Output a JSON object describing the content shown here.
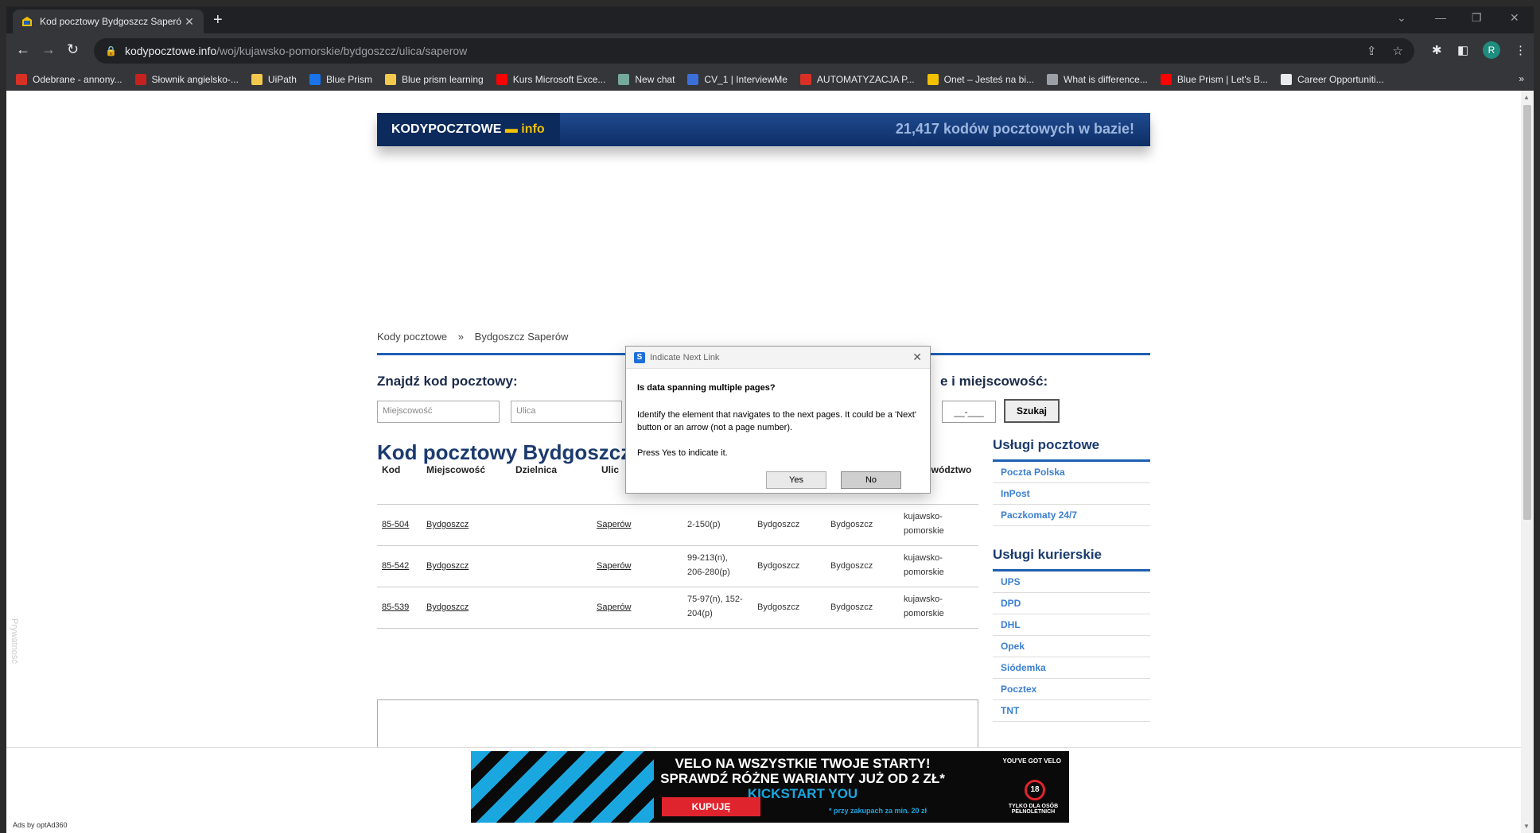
{
  "browser": {
    "tab_title": "Kod pocztowy Bydgoszcz Saperó",
    "new_tab": "+",
    "url_host": "kodypocztowe.info",
    "url_path": "/woj/kujawsko-pomorskie/bydgoszcz/ulica/saperow",
    "profile_initial": "R",
    "bookmarks": [
      {
        "label": "Odebrane - annony...",
        "color": "#d93025"
      },
      {
        "label": "Słownik angielsko-...",
        "color": "#c5221f"
      },
      {
        "label": "UiPath",
        "color": "#f2c94c"
      },
      {
        "label": "Blue Prism",
        "color": "#1a73e8"
      },
      {
        "label": "Blue prism learning",
        "color": "#f2c94c"
      },
      {
        "label": "Kurs Microsoft Exce...",
        "color": "#ff0000"
      },
      {
        "label": "New chat",
        "color": "#74aa9c"
      },
      {
        "label": "CV_1 | InterviewMe",
        "color": "#3b6fd9"
      },
      {
        "label": "AUTOMATYZACJA P...",
        "color": "#d93025"
      },
      {
        "label": "Onet – Jesteś na bi...",
        "color": "#f2c100"
      },
      {
        "label": "What is difference...",
        "color": "#9aa0a6"
      },
      {
        "label": "Blue Prism | Let's B...",
        "color": "#ff0000"
      },
      {
        "label": "Career Opportuniti...",
        "color": "#e8eaed"
      }
    ],
    "bookmarks_more": "»"
  },
  "site": {
    "logo_main": "KODYPOCZTOWE",
    "logo_info": "info",
    "banner_text": "21,417 kodów pocztowych w bazie!",
    "breadcrumb": [
      "Kody pocztowe",
      "»",
      "Bydgoszcz Saperów"
    ],
    "find_title": "Znajdź kod pocztowy:",
    "find_right": "e i miejscowość:",
    "city_placeholder": "Miejscowość",
    "street_placeholder": "Ulica",
    "postcode_mask": "__-___",
    "search_button": "Szukaj",
    "main_title": "Kod pocztowy Bydgoszcz",
    "columns": [
      "Kod",
      "Miejscowość",
      "Dzielnica",
      "Ulic",
      "ewództwo"
    ],
    "rows": [
      {
        "kod": "85-504",
        "miejscowosc": "Bydgoszcz",
        "ulica": "Saperów",
        "numery": "2-150(p)",
        "gmina": "Bydgoszcz",
        "powiat": "Bydgoszcz",
        "wojewodztwo": "kujawsko-pomorskie"
      },
      {
        "kod": "85-542",
        "miejscowosc": "Bydgoszcz",
        "ulica": "Saperów",
        "numery": "99-213(n), 206-280(p)",
        "gmina": "Bydgoszcz",
        "powiat": "Bydgoszcz",
        "wojewodztwo": "kujawsko-pomorskie"
      },
      {
        "kod": "85-539",
        "miejscowosc": "Bydgoszcz",
        "ulica": "Saperów",
        "numery": "75-97(n), 152-204(p)",
        "gmina": "Bydgoszcz",
        "powiat": "Bydgoszcz",
        "wojewodztwo": "kujawsko-pomorskie"
      }
    ],
    "postal_title": "Usługi pocztowe",
    "postal_items": [
      "Poczta Polska",
      "InPost",
      "Paczkomaty 24/7"
    ],
    "courier_title": "Usługi kurierskie",
    "courier_items": [
      "UPS",
      "DPD",
      "DHL",
      "Opek",
      "Siódemka",
      "Pocztex",
      "TNT"
    ],
    "privacy": "Prywatność"
  },
  "ad": {
    "credit": "Ads by optAd360",
    "headline": "VELO NA WSZYSTKIE TWOJE STARTY! SPRAWDŹ RÓŻNE WARIANTY JUŻ OD 2 ZŁ*",
    "kickstart": "KICKSTART YOU",
    "buy": "KUPUJĘ",
    "small": "* przy zakupach za min. 20 zł",
    "got_velo": "YOU'VE GOT VELO",
    "age_badge": "18",
    "adult": "TYLKO DLA OSÓB PEŁNOLETNICH"
  },
  "dialog": {
    "title": "Indicate Next Link",
    "question": "Is data spanning multiple pages?",
    "description": "Identify the element that navigates to the next pages. It could be a 'Next' button or an arrow (not a page number).",
    "press": "Press Yes to indicate it.",
    "yes": "Yes",
    "no": "No"
  }
}
